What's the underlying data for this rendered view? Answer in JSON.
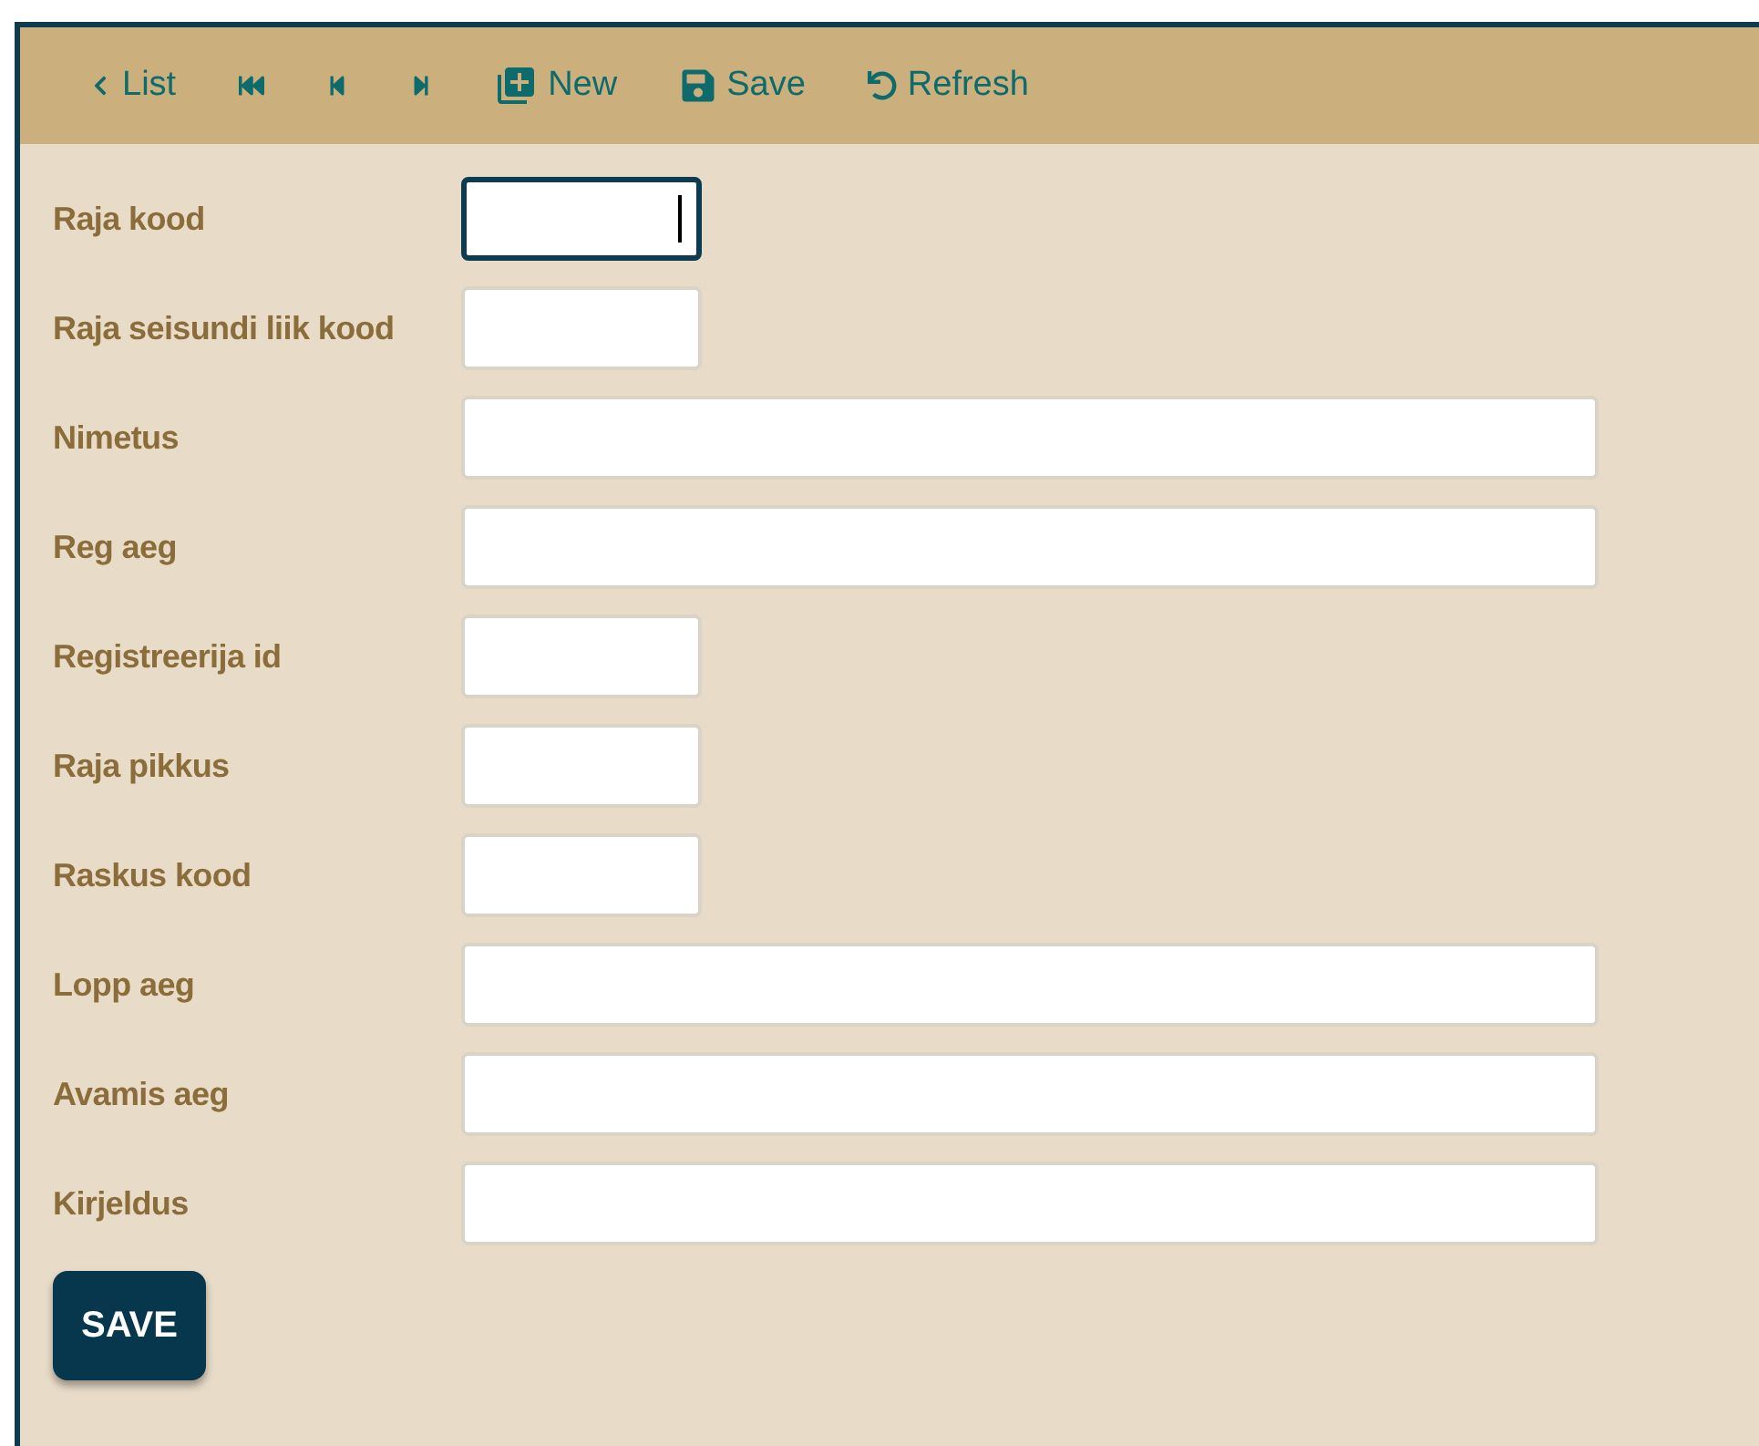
{
  "toolbar": [
    {
      "kind": "back",
      "label": "List"
    },
    {
      "kind": "first"
    },
    {
      "kind": "prev"
    },
    {
      "kind": "next"
    },
    {
      "kind": "new",
      "label": "New"
    },
    {
      "kind": "save",
      "label": "Save"
    },
    {
      "kind": "refresh",
      "label": "Refresh"
    }
  ],
  "fields": [
    {
      "label": "Raja kood",
      "kind": "short",
      "focused": true
    },
    {
      "label": "Raja seisundi liik kood",
      "kind": "short",
      "focused": false
    },
    {
      "label": "Nimetus",
      "kind": "long",
      "focused": false
    },
    {
      "label": "Reg aeg",
      "kind": "long",
      "focused": false
    },
    {
      "label": "Registreerija id",
      "kind": "short",
      "focused": false
    },
    {
      "label": "Raja pikkus",
      "kind": "short",
      "focused": false
    },
    {
      "label": "Raskus kood",
      "kind": "short",
      "focused": false
    },
    {
      "label": "Lopp aeg",
      "kind": "long",
      "focused": false
    },
    {
      "label": "Avamis aeg",
      "kind": "long",
      "focused": false
    },
    {
      "label": "Kirjeldus",
      "kind": "long",
      "focused": false
    }
  ],
  "submit": "SAVE"
}
